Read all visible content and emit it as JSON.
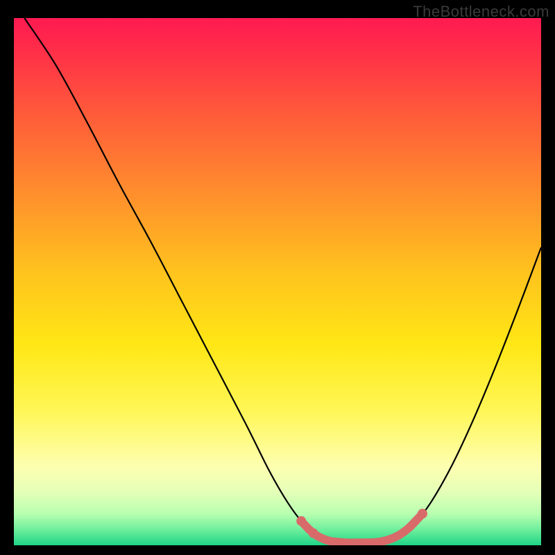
{
  "watermark": "TheBottleneck.com",
  "chart_data": {
    "type": "line",
    "title": "",
    "xlabel": "",
    "ylabel": "",
    "xlim": [
      0,
      100
    ],
    "ylim": [
      0,
      100
    ],
    "gradient_stops": [
      {
        "offset": 0.0,
        "color": "#ff1a52"
      },
      {
        "offset": 0.05,
        "color": "#ff2a4a"
      },
      {
        "offset": 0.18,
        "color": "#ff5a3a"
      },
      {
        "offset": 0.32,
        "color": "#ff8a2e"
      },
      {
        "offset": 0.48,
        "color": "#ffc21e"
      },
      {
        "offset": 0.62,
        "color": "#ffe715"
      },
      {
        "offset": 0.75,
        "color": "#fff75a"
      },
      {
        "offset": 0.85,
        "color": "#fdffb0"
      },
      {
        "offset": 0.9,
        "color": "#e4ffb8"
      },
      {
        "offset": 0.94,
        "color": "#b8ffb0"
      },
      {
        "offset": 0.97,
        "color": "#6fef9c"
      },
      {
        "offset": 1.0,
        "color": "#1fd487"
      }
    ],
    "series": [
      {
        "name": "bottleneck-curve",
        "stroke": "#000000",
        "stroke_width": 2.2,
        "points": [
          {
            "x": 2.0,
            "y": 100.0
          },
          {
            "x": 8.0,
            "y": 91.0
          },
          {
            "x": 14.0,
            "y": 80.0
          },
          {
            "x": 20.0,
            "y": 68.5
          },
          {
            "x": 26.0,
            "y": 57.5
          },
          {
            "x": 32.0,
            "y": 46.0
          },
          {
            "x": 38.0,
            "y": 34.5
          },
          {
            "x": 44.0,
            "y": 23.0
          },
          {
            "x": 48.5,
            "y": 14.0
          },
          {
            "x": 52.0,
            "y": 8.0
          },
          {
            "x": 55.0,
            "y": 4.0
          },
          {
            "x": 57.5,
            "y": 1.8
          },
          {
            "x": 60.0,
            "y": 0.8
          },
          {
            "x": 64.0,
            "y": 0.5
          },
          {
            "x": 68.0,
            "y": 0.5
          },
          {
            "x": 71.0,
            "y": 1.0
          },
          {
            "x": 73.5,
            "y": 2.2
          },
          {
            "x": 76.0,
            "y": 4.2
          },
          {
            "x": 79.0,
            "y": 8.0
          },
          {
            "x": 83.0,
            "y": 15.0
          },
          {
            "x": 87.0,
            "y": 23.5
          },
          {
            "x": 91.0,
            "y": 33.0
          },
          {
            "x": 95.5,
            "y": 44.5
          },
          {
            "x": 100.0,
            "y": 56.5
          }
        ]
      },
      {
        "name": "optimal-segment",
        "stroke": "#d86a6a",
        "stroke_width": 12,
        "linecap": "round",
        "points": [
          {
            "x": 54.5,
            "y": 4.6
          },
          {
            "x": 56.0,
            "y": 3.0
          },
          {
            "x": 57.2,
            "y": 2.0
          },
          {
            "x": 58.5,
            "y": 1.3
          },
          {
            "x": 60.0,
            "y": 0.8
          },
          {
            "x": 63.0,
            "y": 0.5
          },
          {
            "x": 66.0,
            "y": 0.5
          },
          {
            "x": 69.0,
            "y": 0.6
          },
          {
            "x": 71.2,
            "y": 1.1
          },
          {
            "x": 73.0,
            "y": 1.9
          },
          {
            "x": 74.8,
            "y": 3.2
          },
          {
            "x": 76.3,
            "y": 4.7
          },
          {
            "x": 77.5,
            "y": 6.0
          }
        ]
      }
    ],
    "markers": {
      "color": "#d86a6a",
      "radius": 7,
      "points": [
        {
          "x": 54.5,
          "y": 4.6
        },
        {
          "x": 56.8,
          "y": 2.3
        },
        {
          "x": 77.5,
          "y": 6.0
        }
      ]
    }
  }
}
